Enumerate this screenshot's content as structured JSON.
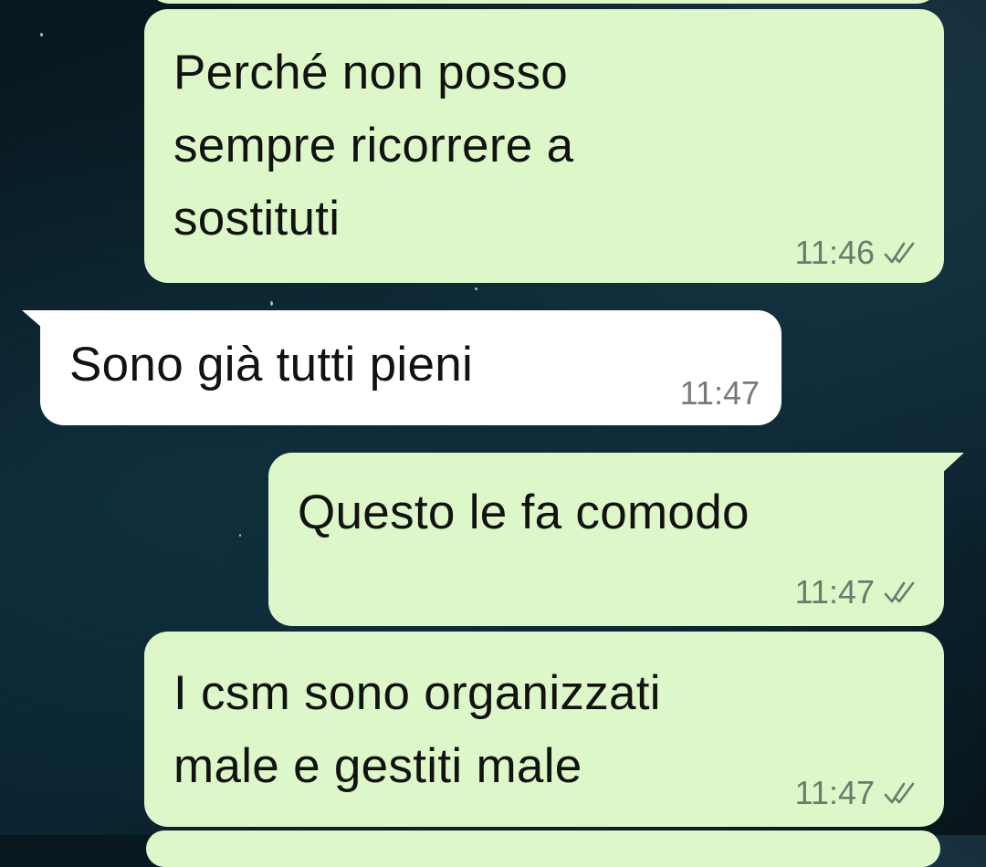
{
  "messages": [
    {
      "direction": "outgoing",
      "lines": [
        "Perché non posso",
        "sempre ricorrere a",
        "sostituti"
      ],
      "time": "11:46",
      "status_icon": "double-check-icon"
    },
    {
      "direction": "incoming",
      "lines": [
        "Sono già tutti pieni"
      ],
      "time": "11:47"
    },
    {
      "direction": "outgoing",
      "lines": [
        "Questo le fa comodo"
      ],
      "time": "11:47",
      "status_icon": "double-check-icon"
    },
    {
      "direction": "outgoing",
      "lines": [
        "I csm sono organizzati",
        "male e gestiti male"
      ],
      "time": "11:47",
      "status_icon": "double-check-icon"
    }
  ],
  "colors": {
    "outgoing_bubble": "#ddf7c8",
    "incoming_bubble": "#ffffff",
    "tick_color": "#6c7a6e",
    "background": "#0b2631"
  }
}
